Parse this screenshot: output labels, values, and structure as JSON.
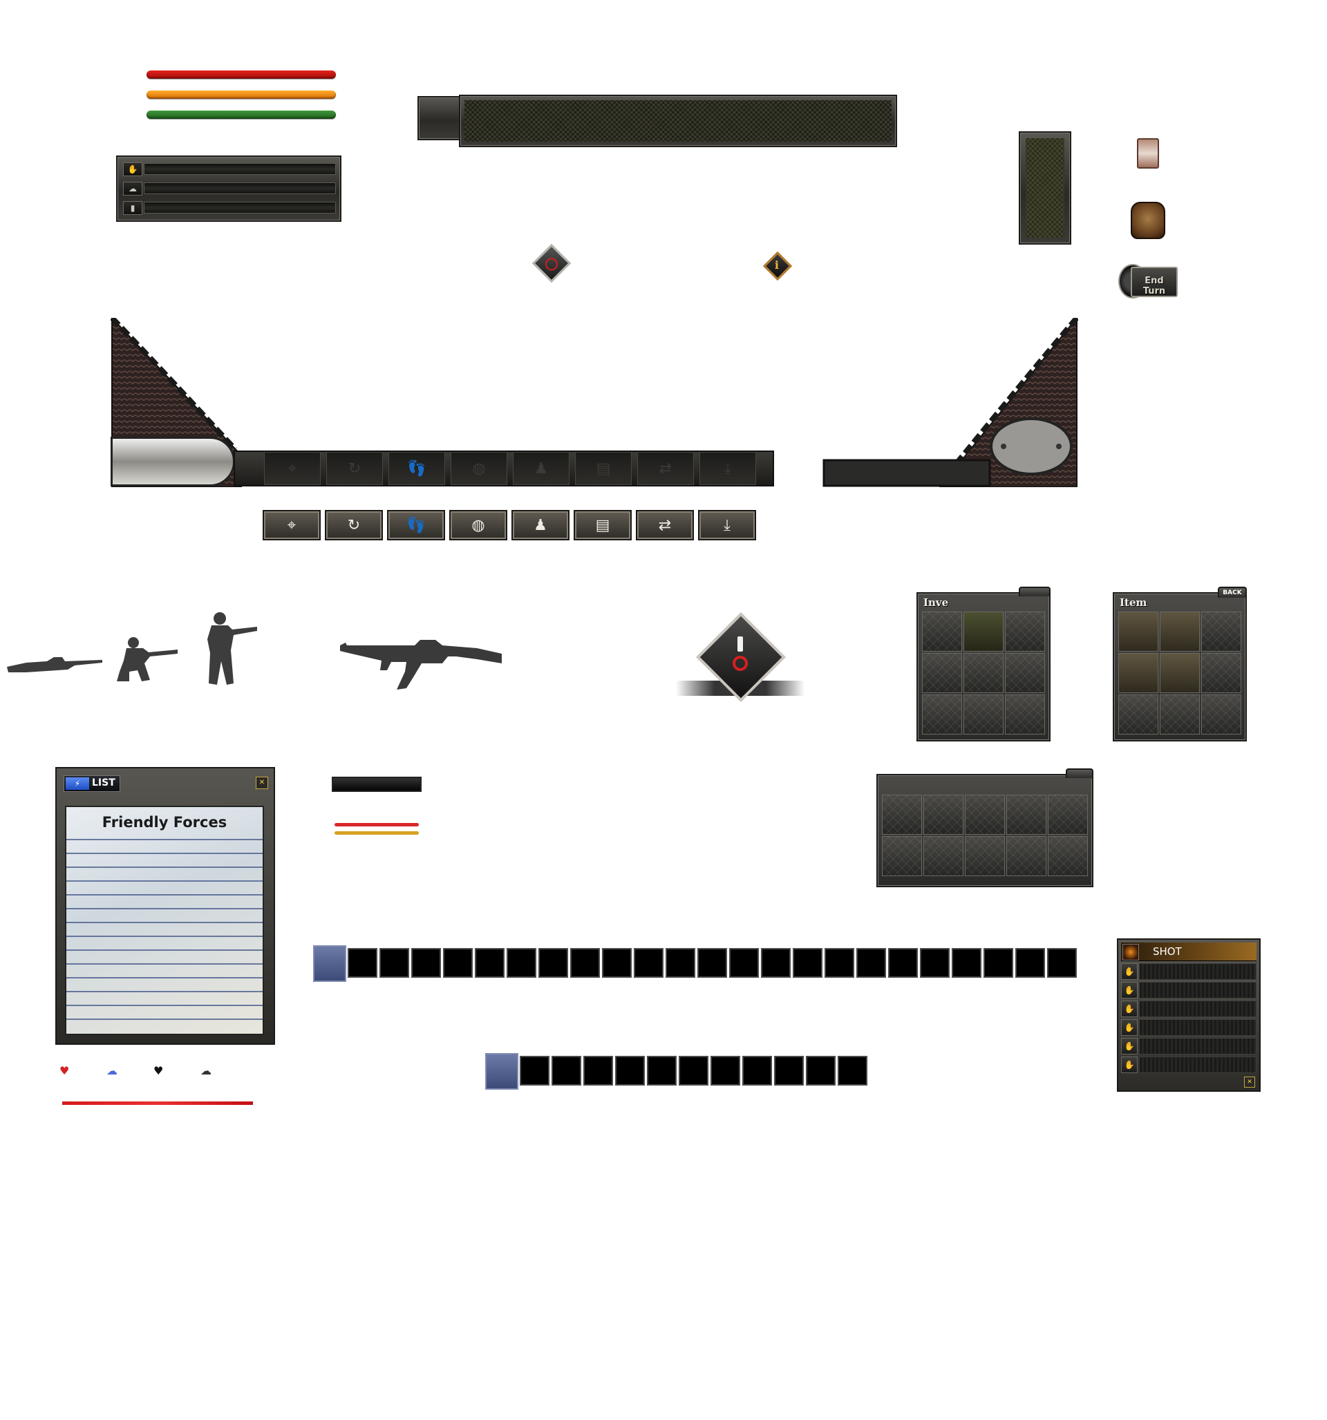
{
  "colors": {
    "health_bar": "#c8140e",
    "stamina_bar": "#f08c10",
    "morale_bar": "#2f7c2a",
    "bar_red": "#d8262a",
    "bar_yellow": "#d6a020",
    "accent_blue": "#3d4f86",
    "end_turn_text": "#d9d4c7"
  },
  "end_turn": {
    "label": "End Turn"
  },
  "inventory_panels": [
    {
      "title": "Inve",
      "tab": ""
    },
    {
      "title": "Item",
      "tab": "BACK"
    }
  ],
  "list_panel": {
    "tab_label": "LIST",
    "close_label": "✕",
    "heading": "Friendly Forces"
  },
  "shot_panel": {
    "title": "SHOT",
    "close_label": "✕"
  },
  "action_icons": [
    "crosshair-icon",
    "rotate-icon",
    "footsteps-icon",
    "backpack-icon",
    "kneel-shoot-icon",
    "supplies-icon",
    "swap-icon",
    "parachute-icon"
  ],
  "status_icons": [
    "heart-icon",
    "brain-icon",
    "heart-dark-icon",
    "brain-dark-icon"
  ],
  "stance_icons": [
    "prone-soldier-icon",
    "kneeling-soldier-icon",
    "standing-soldier-icon"
  ],
  "weapon_icon": "rifle-icon"
}
